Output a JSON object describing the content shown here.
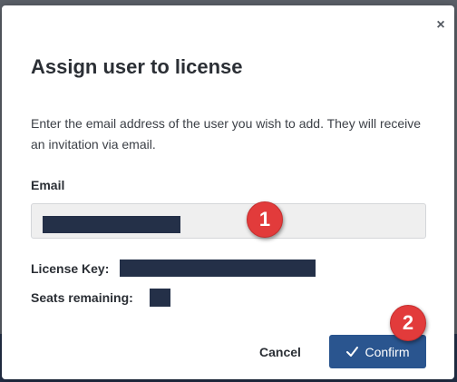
{
  "dialog": {
    "close_glyph": "×",
    "title": "Assign user to license",
    "description": "Enter the email address of the user you wish to add. They will receive an invitation via email.",
    "email": {
      "label": "Email",
      "value_redacted": true
    },
    "license_key": {
      "label": "License Key:",
      "value_redacted": true
    },
    "seats_remaining": {
      "label": "Seats remaining:",
      "value_redacted": true
    },
    "buttons": {
      "cancel_label": "Cancel",
      "confirm_label": "Confirm"
    }
  },
  "annotations": {
    "marker_1": "1",
    "marker_2": "2"
  },
  "icons": {
    "close": "close-icon",
    "confirm": "check-icon"
  },
  "colors": {
    "primary": "#2a558f",
    "marker": "#e23b3b",
    "redaction": "#243048"
  }
}
